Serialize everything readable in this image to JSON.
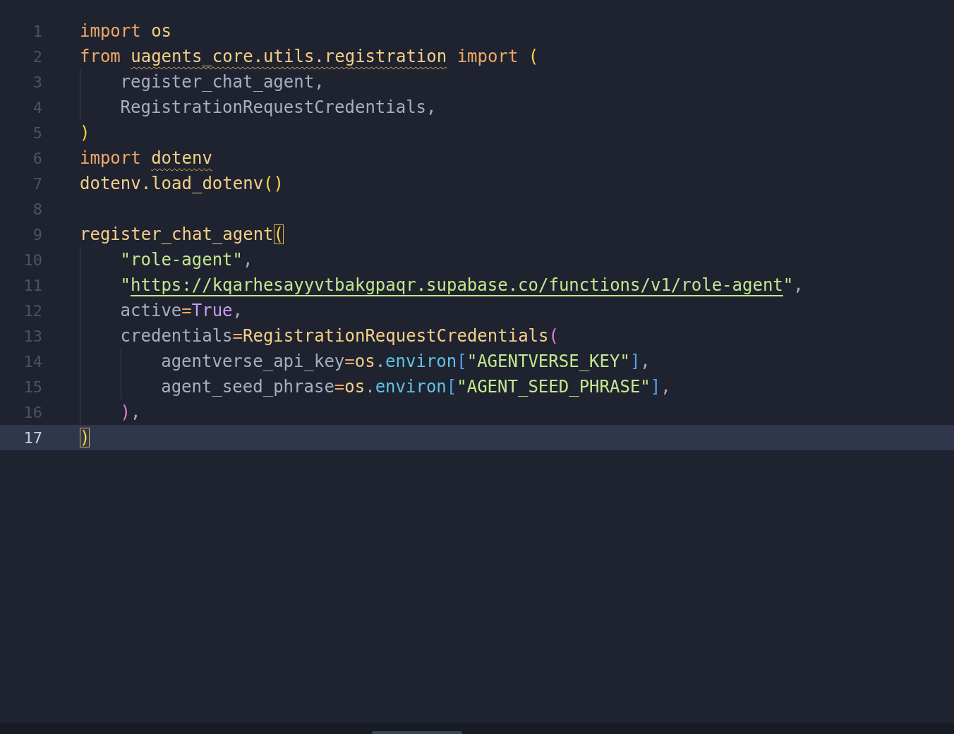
{
  "editor": {
    "lines": [
      {
        "number": "1",
        "selected": false,
        "tokens": [
          {
            "text": "import ",
            "kind": "keyword"
          },
          {
            "text": "os",
            "kind": "name"
          }
        ]
      },
      {
        "number": "2",
        "selected": false,
        "tokens": [
          {
            "text": "from ",
            "kind": "keyword"
          },
          {
            "text": "uagents_core.utils.registration",
            "kind": "name",
            "squiggle": true
          },
          {
            "text": " import ",
            "kind": "keyword"
          },
          {
            "text": "(",
            "kind": "paren"
          }
        ],
        "children": [
          {
            "number": "3",
            "selected": false,
            "tokens": [
              {
                "text": "register_chat_agent,",
                "kind": "plain"
              }
            ]
          },
          {
            "number": "4",
            "selected": false,
            "tokens": [
              {
                "text": "RegistrationRequestCredentials,",
                "kind": "plain"
              }
            ]
          }
        ]
      },
      {
        "number": "5",
        "selected": false,
        "tokens": [
          {
            "text": ")",
            "kind": "paren"
          }
        ]
      },
      {
        "number": "6",
        "selected": false,
        "tokens": [
          {
            "text": "import ",
            "kind": "keyword"
          },
          {
            "text": "dotenv",
            "kind": "name",
            "squiggle": true
          }
        ]
      },
      {
        "number": "7",
        "selected": false,
        "tokens": [
          {
            "text": "dotenv.load_dotenv",
            "kind": "name"
          },
          {
            "text": "()",
            "kind": "paren"
          }
        ]
      },
      {
        "number": "8",
        "selected": false
      },
      {
        "number": "9",
        "selected": false,
        "tokens": [
          {
            "text": "register_chat_agent",
            "kind": "name"
          },
          {
            "text": "(",
            "kind": "paren",
            "matched": true
          }
        ],
        "children": [
          {
            "number": "10",
            "selected": false,
            "tokens": [
              {
                "text": "\"role-agent\"",
                "kind": "string"
              },
              {
                "text": ",",
                "kind": "plain"
              }
            ]
          },
          {
            "number": "11",
            "selected": false,
            "tokens": [
              {
                "text": "\"",
                "kind": "string"
              },
              {
                "text": "https://kqarhesayyvtbakgpaqr.supabase.co/functions/v1/role-agent",
                "kind": "link"
              },
              {
                "text": "\"",
                "kind": "string"
              },
              {
                "text": ",",
                "kind": "plain"
              }
            ]
          },
          {
            "number": "12",
            "selected": false,
            "tokens": [
              {
                "text": "active",
                "kind": "plain"
              },
              {
                "text": "=",
                "kind": "operator"
              },
              {
                "text": "True",
                "kind": "boolean"
              },
              {
                "text": ",",
                "kind": "plain"
              }
            ]
          },
          {
            "number": "13",
            "selected": false,
            "tokens": [
              {
                "text": "credentials",
                "kind": "plain"
              },
              {
                "text": "=",
                "kind": "operator"
              },
              {
                "text": "RegistrationRequestCredentials",
                "kind": "name"
              },
              {
                "text": "(",
                "kind": "paren2"
              }
            ],
            "children": [
              {
                "number": "14",
                "selected": false,
                "tokens": [
                  {
                    "text": "agentverse_api_key",
                    "kind": "plain"
                  },
                  {
                    "text": "=",
                    "kind": "operator"
                  },
                  {
                    "text": "os",
                    "kind": "name"
                  },
                  {
                    "text": ".",
                    "kind": "plain"
                  },
                  {
                    "text": "environ",
                    "kind": "property"
                  },
                  {
                    "text": "[",
                    "kind": "bracket"
                  },
                  {
                    "text": "\"AGENTVERSE_KEY\"",
                    "kind": "string"
                  },
                  {
                    "text": "]",
                    "kind": "bracket"
                  },
                  {
                    "text": ",",
                    "kind": "plain"
                  }
                ]
              },
              {
                "number": "15",
                "selected": false,
                "tokens": [
                  {
                    "text": "agent_seed_phrase",
                    "kind": "plain"
                  },
                  {
                    "text": "=",
                    "kind": "operator"
                  },
                  {
                    "text": "os",
                    "kind": "name"
                  },
                  {
                    "text": ".",
                    "kind": "plain"
                  },
                  {
                    "text": "environ",
                    "kind": "property"
                  },
                  {
                    "text": "[",
                    "kind": "bracket"
                  },
                  {
                    "text": "\"AGENT_SEED_PHRASE\"",
                    "kind": "string"
                  },
                  {
                    "text": "]",
                    "kind": "bracket"
                  },
                  {
                    "text": ",",
                    "kind": "plain"
                  }
                ]
              }
            ]
          },
          {
            "number": "16",
            "selected": false,
            "tokens": [
              {
                "text": ")",
                "kind": "paren2"
              },
              {
                "text": ",",
                "kind": "plain"
              }
            ]
          }
        ]
      },
      {
        "number": "17",
        "selected": true,
        "tokens": [
          {
            "text": ")",
            "kind": "paren",
            "matched": true
          }
        ]
      }
    ]
  }
}
